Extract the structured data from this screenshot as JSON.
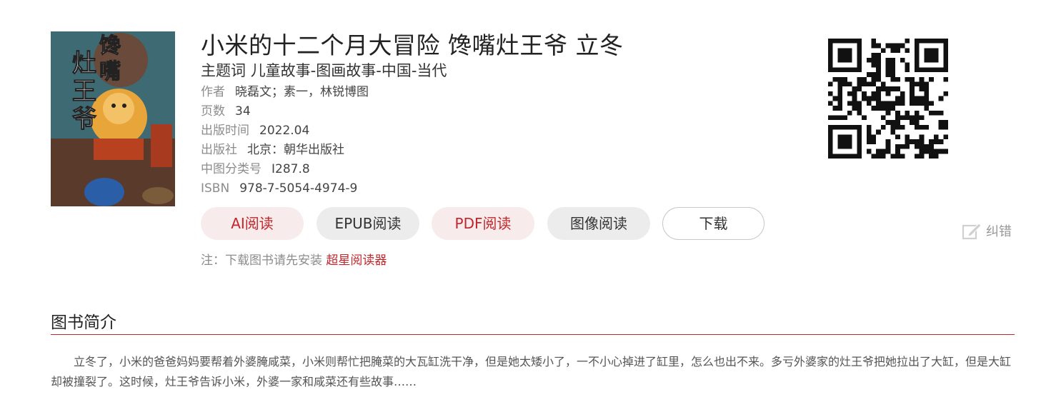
{
  "book": {
    "title": "小米的十二个月大冒险 馋嘴灶王爷 立冬",
    "subject_label": "主题词",
    "subject_value": "儿童故事-图画故事-中国-当代",
    "meta": [
      {
        "key": "作者",
        "value": "晓磊文；素一，林锐博图"
      },
      {
        "key": "页数",
        "value": "34"
      },
      {
        "key": "出版时间",
        "value": "2022.04"
      },
      {
        "key": "出版社",
        "value": "北京：朝华出版社"
      },
      {
        "key": "中图分类号",
        "value": "I287.8"
      },
      {
        "key": "ISBN",
        "value": "978-7-5054-4974-9"
      }
    ],
    "cover_text": [
      "馋",
      "嘴",
      "灶",
      "王",
      "爷"
    ]
  },
  "actions": {
    "ai_read": "AI阅读",
    "epub_read": "EPUB阅读",
    "pdf_read": "PDF阅读",
    "image_read": "图像阅读",
    "download": "下载"
  },
  "note": {
    "text": "注：下载图书请先安装",
    "link": "超星阅读器"
  },
  "correct_label": "纠错",
  "intro": {
    "heading": "图书简介",
    "text": "立冬了，小米的爸爸妈妈要帮着外婆腌咸菜，小米则帮忙把腌菜的大瓦缸洗干净，但是她太矮小了，一不小心掉进了缸里，怎么也出不来。多亏外婆家的灶王爷把她拉出了大缸，但是大缸却被撞裂了。这时候，灶王爷告诉小米，外婆一家和咸菜还有些故事……"
  },
  "colors": {
    "accent": "#c0272d",
    "pink_button_bg": "#f8ebeb",
    "gray_button_bg": "#ececec"
  }
}
